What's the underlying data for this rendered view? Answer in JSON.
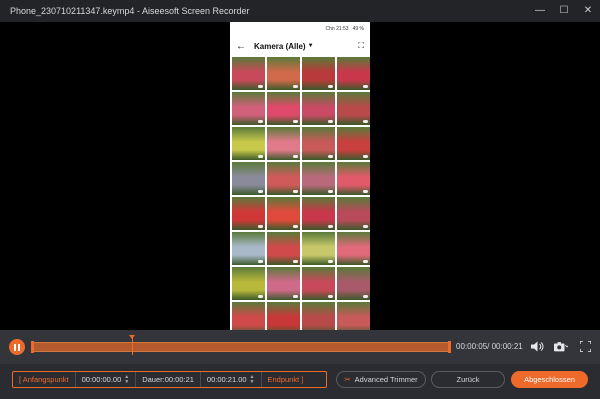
{
  "window": {
    "title": "Phone_230710211347.keymp4  -  Aiseesoft Screen Recorder"
  },
  "window_controls": {
    "minimize": "—",
    "maximize": "☐",
    "close": "✕"
  },
  "phone": {
    "status": "Chn 21:53",
    "battery": "49 %",
    "album_title": "Kamera (Alle)",
    "thumb_colors": [
      "#c84a5a",
      "#d06a4a",
      "#b83a3a",
      "#c8384a",
      "#d0607a",
      "#e04a6a",
      "#c84a64",
      "#b84a4a",
      "#c8c84a",
      "#e07a8a",
      "#c85a5a",
      "#c84040",
      "#8a8a9a",
      "#d05a5a",
      "#b86a7a",
      "#e05a6a",
      "#d03838",
      "#e04a3a",
      "#c8384a",
      "#b84a5a",
      "#a8b8c8",
      "#d04a4a",
      "#c8c86a",
      "#e06a7a",
      "#b8b83a",
      "#d06a8a",
      "#c84a5a",
      "#a85a6a",
      "#d04a4a",
      "#c83838",
      "#b84a4a",
      "#c85a5a"
    ]
  },
  "timeline": {
    "timecode": "00:00:05/ 00:00:21",
    "progress": 0.24
  },
  "controls": {
    "start_label": "[ Anfangspunkt",
    "start_time": "00:00:00.00",
    "duration_label": "Dauer:00:00:21",
    "end_time": "00:00:21.00",
    "end_label": "Endpunkt ]",
    "advanced_trimmer": "Advanced Trimmer",
    "back": "Zurück",
    "finish": "Abgeschlossen"
  },
  "colors": {
    "accent": "#ee6a2a",
    "bg": "#2b2c31",
    "titlebar": "#232428"
  }
}
